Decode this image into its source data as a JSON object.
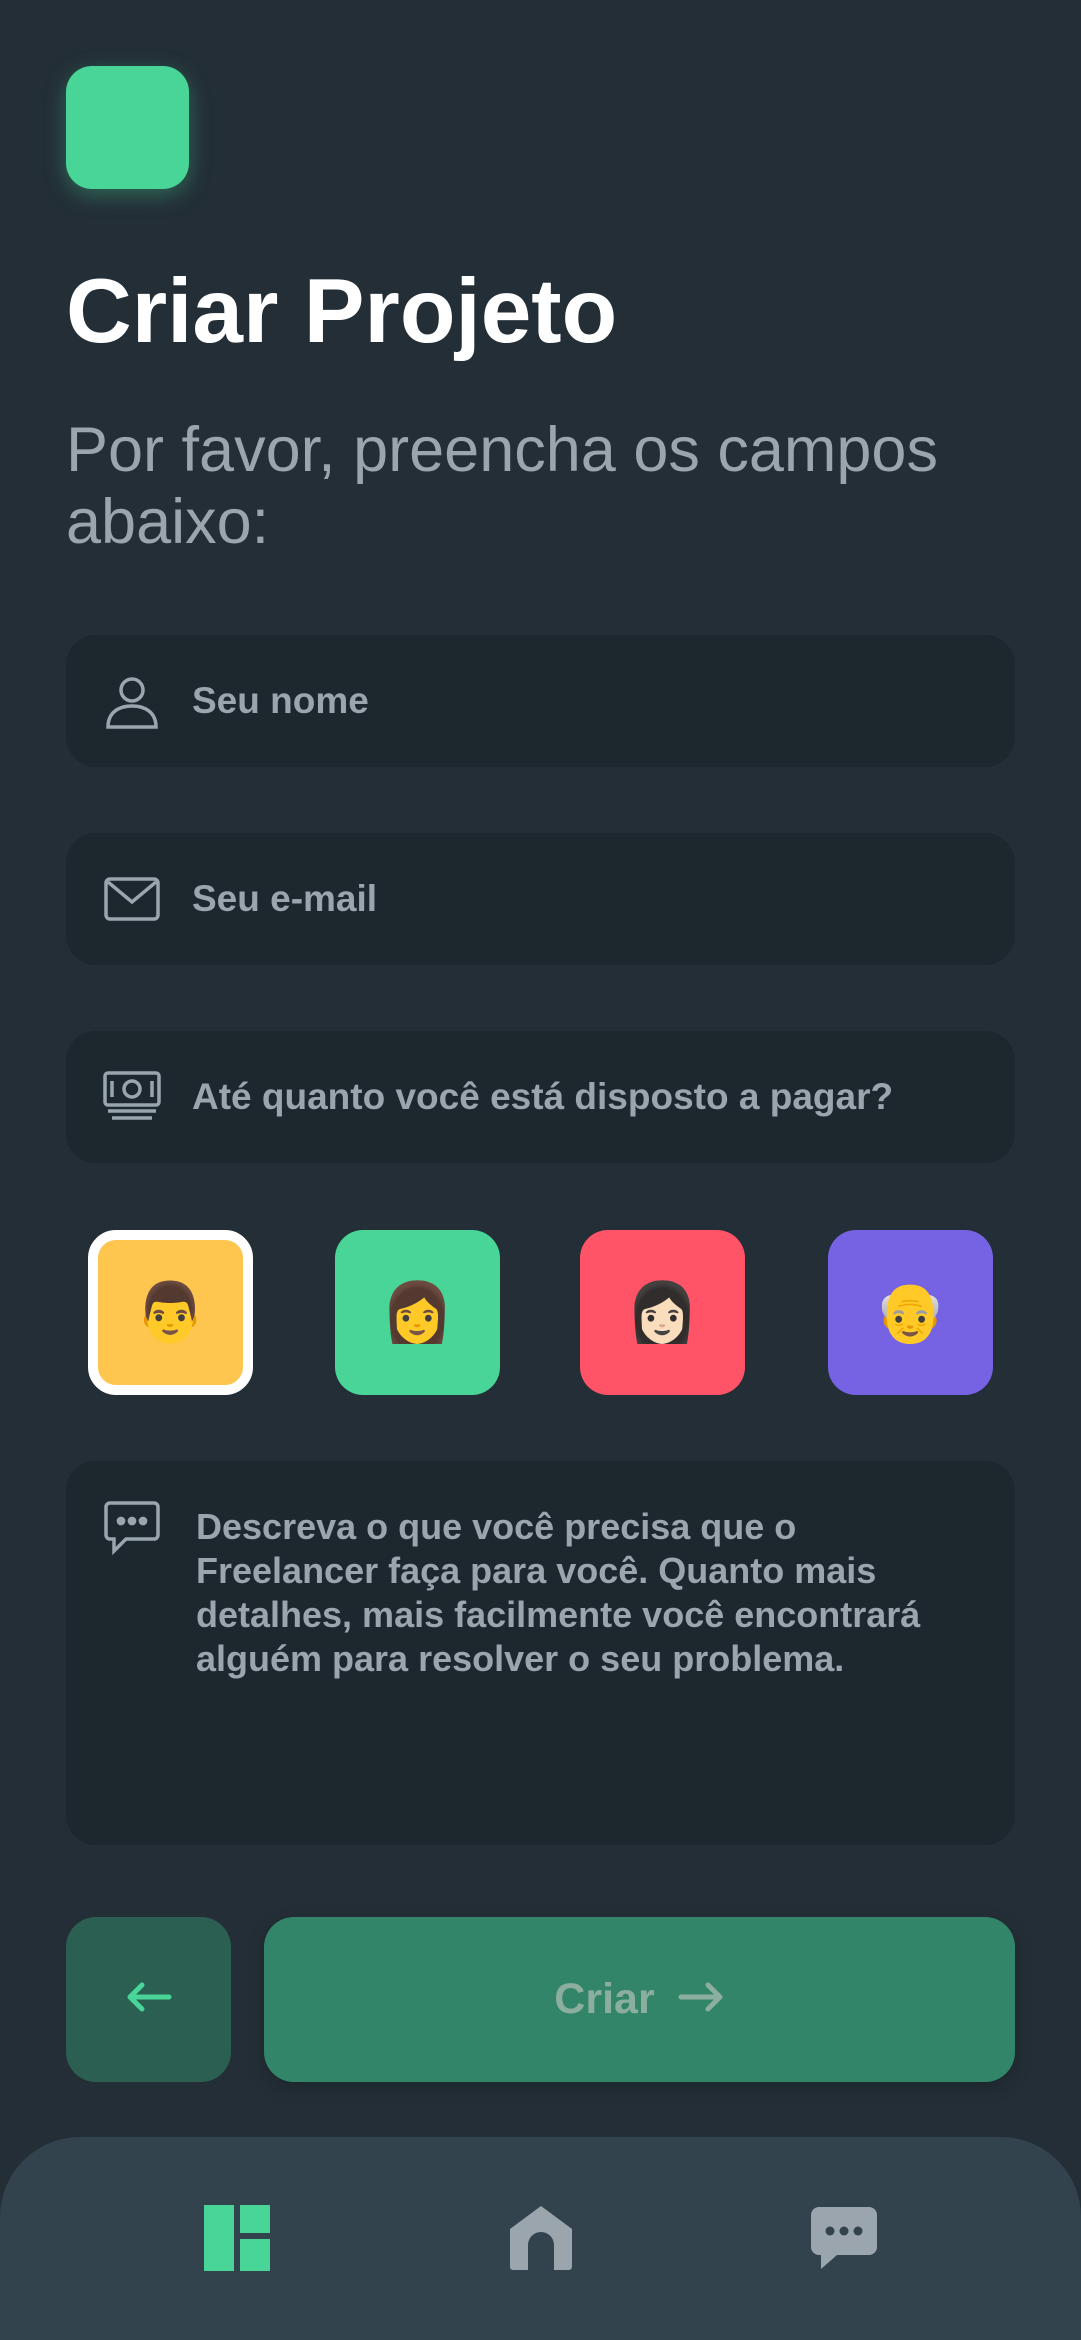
{
  "colors": {
    "background": "#232e36",
    "field_background": "#1d272e",
    "accent": "#48d597",
    "muted_text": "#9aa5ad",
    "nav_background": "#33434e"
  },
  "header": {
    "logo_icon": "app-logo-square",
    "title": "Criar Projeto",
    "subtitle": "Por favor, preencha os campos abaixo:"
  },
  "form": {
    "name_field": {
      "icon": "user-icon",
      "placeholder": "Seu nome"
    },
    "email_field": {
      "icon": "envelope-icon",
      "placeholder": "Seu e-mail"
    },
    "budget_field": {
      "icon": "money-icon",
      "placeholder": "Até quanto você está disposto a pagar?"
    },
    "avatars": [
      {
        "emoji": "👨",
        "color": "#ffc64f",
        "selected": true
      },
      {
        "emoji": "👩",
        "color": "#48d597",
        "selected": false
      },
      {
        "emoji": "👩🏻",
        "color": "#ff5468",
        "selected": false
      },
      {
        "emoji": "👴",
        "color": "#7563e3",
        "selected": false
      }
    ],
    "description_field": {
      "icon": "chat-bubble-icon",
      "placeholder": "Descreva o que você precisa que o Freelancer faça para você. Quanto mais detalhes, mais facilmente você encontrará alguém para resolver o seu problema."
    }
  },
  "actions": {
    "back_icon": "arrow-left-icon",
    "create_label": "Criar",
    "create_icon": "arrow-right-icon"
  },
  "bottom_nav": {
    "items": [
      {
        "icon": "dashboard-icon",
        "active": true
      },
      {
        "icon": "home-icon",
        "active": false
      },
      {
        "icon": "chat-icon",
        "active": false
      }
    ]
  }
}
